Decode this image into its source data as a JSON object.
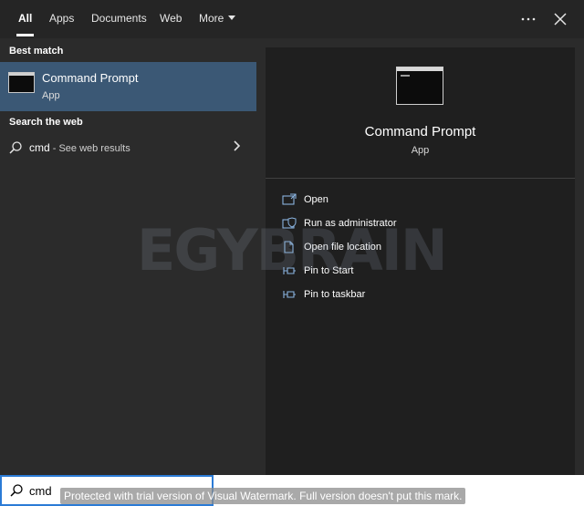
{
  "tabs": [
    {
      "label": "All",
      "active": true
    },
    {
      "label": "Apps",
      "active": false
    },
    {
      "label": "Documents",
      "active": false
    },
    {
      "label": "Web",
      "active": false
    },
    {
      "label": "More",
      "active": false
    }
  ],
  "toolbar_icons": [
    "more-options-icon",
    "close-icon"
  ],
  "left": {
    "best_match_heading": "Best match",
    "best_match": {
      "title": "Command Prompt",
      "subtitle": "App",
      "icon": "command-prompt-icon"
    },
    "web_heading": "Search the web",
    "web_result": {
      "query": "cmd",
      "suffix": " - See web results",
      "icon": "search-icon"
    }
  },
  "preview": {
    "title": "Command Prompt",
    "subtitle": "App",
    "actions": [
      {
        "label": "Open",
        "icon": "open-icon"
      },
      {
        "label": "Run as administrator",
        "icon": "shield-icon"
      },
      {
        "label": "Open file location",
        "icon": "file-location-icon"
      },
      {
        "label": "Pin to Start",
        "icon": "pin-icon"
      },
      {
        "label": "Pin to taskbar",
        "icon": "pin-icon"
      }
    ]
  },
  "watermark_logo": "EGYBRAIN",
  "search": {
    "value": "cmd",
    "placeholder": ""
  },
  "trial_watermark": "Protected with trial version of Visual Watermark. Full version doesn't put this mark.",
  "colors": {
    "accent_highlight": "#3b5875",
    "icon_blue": "#8ab4e0",
    "search_border": "#2b7bd6",
    "panel_dark": "#1f1f1f",
    "panel_mid": "#2b2b2b"
  }
}
